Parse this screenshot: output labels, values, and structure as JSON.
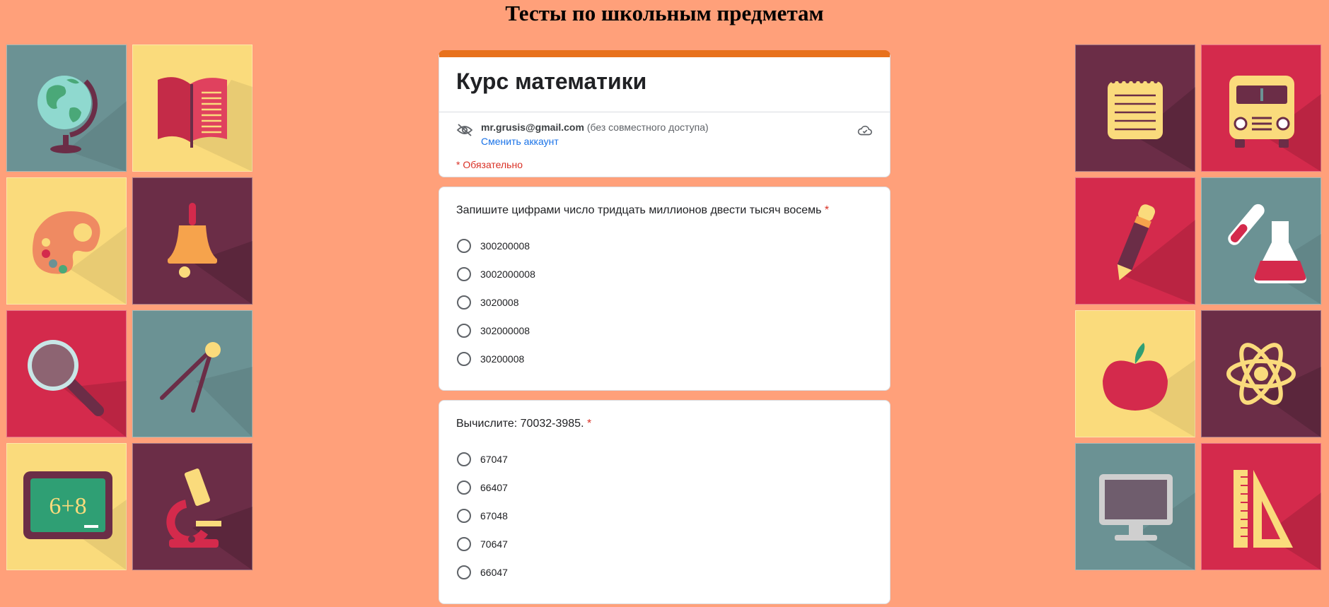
{
  "page": {
    "title": "Тесты по школьным предметам"
  },
  "colors": {
    "background": "#ffa07a",
    "accent": "#e8711c",
    "required": "#d93025",
    "link": "#1a73e8"
  },
  "tiles_left": [
    "globe-icon",
    "book-icon",
    "palette-icon",
    "bell-icon",
    "magnifier-icon",
    "compass-icon",
    "chalkboard-icon",
    "microscope-icon"
  ],
  "tiles_right": [
    "notepad-icon",
    "school-bus-icon",
    "pencil-icon",
    "test-tube-flask-icon",
    "apple-icon",
    "atom-icon",
    "monitor-icon",
    "ruler-triangle-icon"
  ],
  "chalkboard_text": "6+8",
  "form": {
    "title": "Курс математики",
    "account_email": "mr.grusis@gmail.com",
    "account_note": "(без совместного доступа)",
    "switch_account": "Сменить аккаунт",
    "required_note": "* Обязательно"
  },
  "questions": [
    {
      "text": "Запишите цифрами число тридцать миллионов двести тысяч восемь",
      "required_mark": "*",
      "options": [
        "300200008",
        "3002000008",
        "3020008",
        "302000008",
        "30200008"
      ]
    },
    {
      "text": "Вычислите: 70032-3985.",
      "required_mark": "*",
      "options": [
        "67047",
        "66407",
        "67048",
        "70647",
        "66047"
      ]
    }
  ]
}
